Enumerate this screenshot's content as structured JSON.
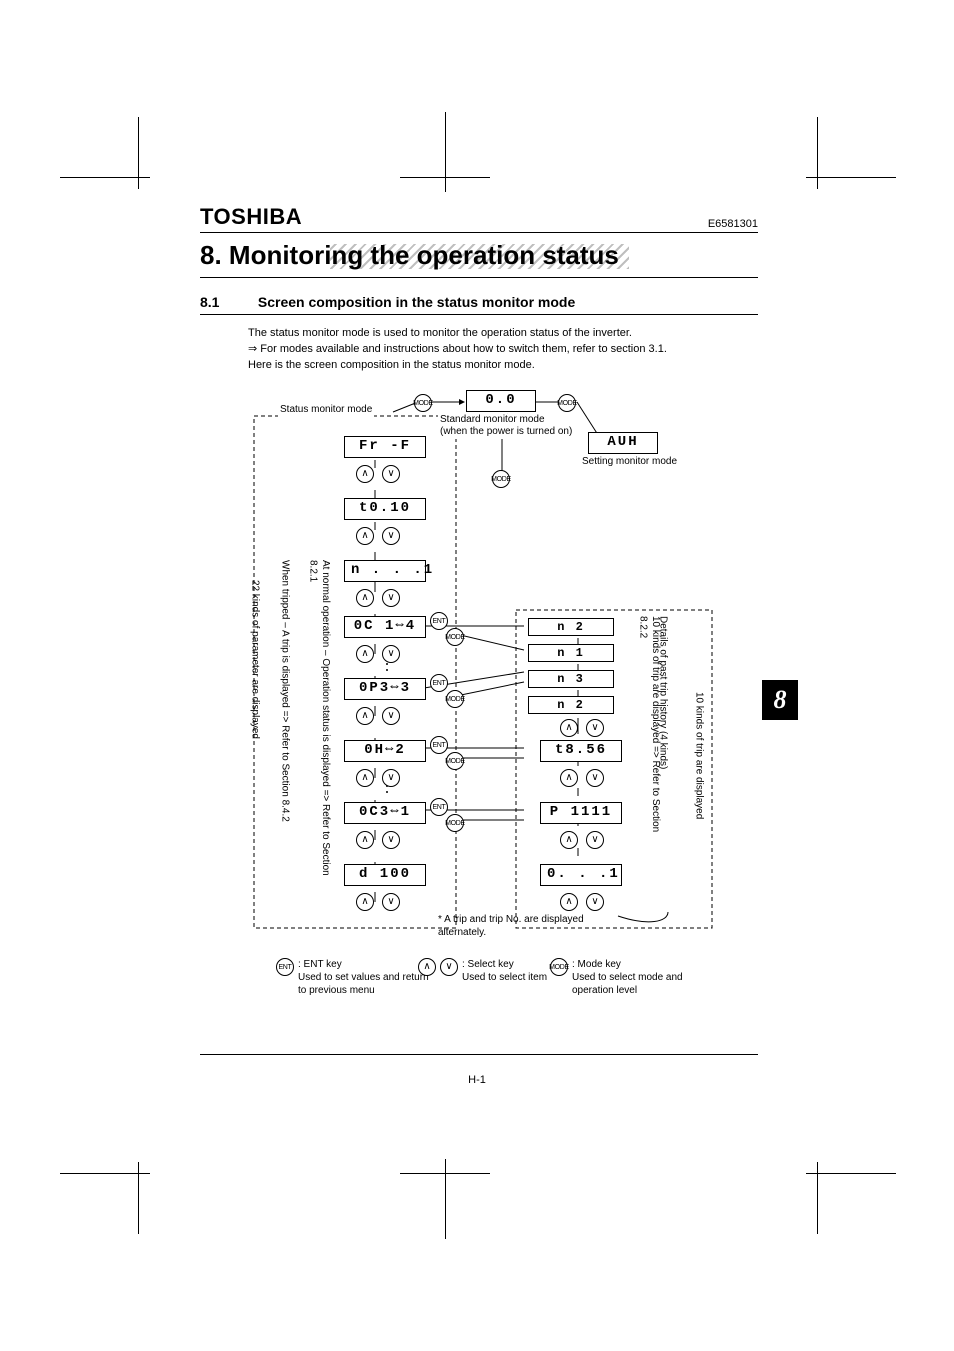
{
  "header": {
    "brand": "TOSHIBA",
    "docnum": "E6581301"
  },
  "chapter_title": "8. Monitoring the operation status",
  "section": {
    "num": "8.1",
    "title": "Screen composition in the status monitor mode"
  },
  "body": {
    "p1": "The status monitor mode is used to monitor the operation status of the inverter.",
    "p2_prefix": "⇒",
    "p2": "For modes available and instructions about how to switch them, refer to section 3.1.",
    "p3": "Here is the screen composition in the status monitor mode."
  },
  "modes": {
    "status_monitor": "Status monitor mode",
    "standard": "Standard monitor mode",
    "standard_note": "(when the power is turned on)",
    "setting": "Setting monitor mode"
  },
  "segments": {
    "top": "0.0",
    "auh": "AUH",
    "fr_f": "Fr -F",
    "t010": "t0.10",
    "n_1": "n . . .1",
    "oc1_4": "0C 1⇔4",
    "op3_3": "0P3⇔3",
    "oh_2": "0H⇔2",
    "oc3_1": "0C3⇔1",
    "d100": "d 100",
    "n2": "n    2",
    "n1": "n    1",
    "n3": "n    3",
    "n2b": "n    2",
    "t856": "t8.56",
    "p1111": "P 1111",
    "o_1": "0. . .1"
  },
  "icons": {
    "up": "∧",
    "down": "∨",
    "ent": "ENT",
    "mode": "MODE"
  },
  "side": {
    "left_a": "22 kinds of parameter are displayed",
    "left_b": "When tripped – A trip is displayed => Refer to Section 8.4.2",
    "left_c": "At normal operation – Operation status is displayed => Refer to Section 8.2.1",
    "right_a": "10 kinds of trip are displayed  => Refer to Section 8.2.2",
    "right_b": "Details of past trip history (4 kinds)",
    "right_c": "10 kinds of trip are displayed"
  },
  "footnote_star": "* A trip and trip No. are displayed alternately.",
  "keys": {
    "ent": {
      "name": ": ENT key",
      "desc": "Used to set values and return to previous menu"
    },
    "select": {
      "name": ": Select key",
      "desc": "Used to select item"
    },
    "mode": {
      "name": ": Mode key",
      "desc": "Used to select mode and operation level"
    }
  },
  "page_tab": "8",
  "pagenum": "H-1"
}
